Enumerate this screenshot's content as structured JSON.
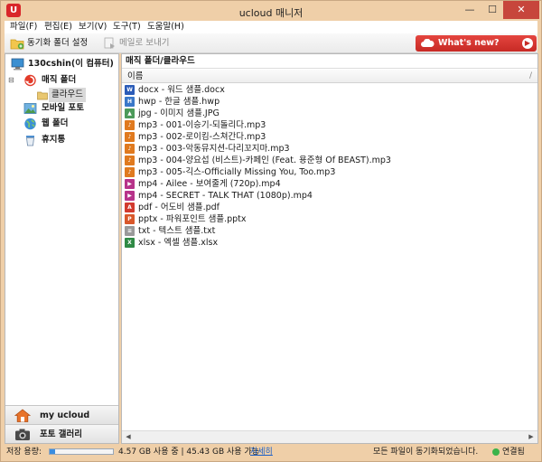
{
  "window": {
    "title": "ucloud 매니저",
    "logo": "U",
    "controls": {
      "minimize": "—",
      "maximize": "☐",
      "close": "✕"
    }
  },
  "menu": [
    "파일(F)",
    "편집(E)",
    "보기(V)",
    "도구(T)",
    "도움말(H)"
  ],
  "toolbar": {
    "sync_folder_label": "동기화 폴더 설정",
    "send_mail_label": "메일로 보내기",
    "whats_new_label": "What's new?",
    "whats_new_arrow": "▶"
  },
  "sidebar": {
    "root": {
      "label": "130cshin(이 컴퓨터)",
      "icon": "computer-icon"
    },
    "items": [
      {
        "label": "매직 폴더",
        "icon": "magic-folder-icon",
        "expander": "⊟"
      },
      {
        "label": "클라우드",
        "icon": "folder-icon"
      },
      {
        "label": "모바일 포토",
        "icon": "mobile-photo-icon"
      },
      {
        "label": "웹 폴더",
        "icon": "globe-icon"
      },
      {
        "label": "휴지통",
        "icon": "trash-icon"
      }
    ],
    "bottom_nav": [
      {
        "label": "my ucloud",
        "icon": "home-icon"
      },
      {
        "label": "포토 갤러리",
        "icon": "camera-icon"
      }
    ]
  },
  "main": {
    "path": "매직 폴더/클라우드",
    "column_header": "이름",
    "column_sep": "/",
    "files": [
      {
        "name": "docx - 워드 샘플.docx",
        "icon": "word-icon",
        "color": "#2b5cb8",
        "glyph": "W"
      },
      {
        "name": "hwp - 한글 샘플.hwp",
        "icon": "hwp-icon",
        "color": "#3a78c9",
        "glyph": "H"
      },
      {
        "name": "jpg - 이미지 샘플.JPG",
        "icon": "image-icon",
        "color": "#4c9a5a",
        "glyph": "▲"
      },
      {
        "name": "mp3 - 001-이승기-되돌리다.mp3",
        "icon": "audio-icon",
        "color": "#e07a1f",
        "glyph": "♪"
      },
      {
        "name": "mp3 - 002-로이킴-스쳐간다.mp3",
        "icon": "audio-icon",
        "color": "#e07a1f",
        "glyph": "♪"
      },
      {
        "name": "mp3 - 003-악동뮤지션-다리꼬지마.mp3",
        "icon": "audio-icon",
        "color": "#e07a1f",
        "glyph": "♪"
      },
      {
        "name": "mp3 - 004-양요섭 (비스트)-카페인 (Feat. 용준형 Of BEAST).mp3",
        "icon": "audio-icon",
        "color": "#e07a1f",
        "glyph": "♪"
      },
      {
        "name": "mp3 - 005-긱스-Officially Missing You, Too.mp3",
        "icon": "audio-icon",
        "color": "#e07a1f",
        "glyph": "♪"
      },
      {
        "name": "mp4 - Ailee - 보여줄게 (720p).mp4",
        "icon": "video-icon",
        "color": "#b7338a",
        "glyph": "▶"
      },
      {
        "name": "mp4 - SECRET - TALK THAT (1080p).mp4",
        "icon": "video-icon",
        "color": "#b7338a",
        "glyph": "▶"
      },
      {
        "name": "pdf - 어도비 샘플.pdf",
        "icon": "pdf-icon",
        "color": "#d23a2e",
        "glyph": "A"
      },
      {
        "name": "pptx - 파워포인트 샘플.pptx",
        "icon": "powerpoint-icon",
        "color": "#d9582b",
        "glyph": "P"
      },
      {
        "name": "txt - 텍스트 샘플.txt",
        "icon": "text-file-icon",
        "color": "#9a9a9a",
        "glyph": "≡"
      },
      {
        "name": "xlsx - 엑셀 샘플.xlsx",
        "icon": "excel-icon",
        "color": "#2f8a45",
        "glyph": "X"
      }
    ],
    "scroll": {
      "left": "◀",
      "right": "▶"
    }
  },
  "status": {
    "storage_label": "저장 용량:",
    "storage_used_fraction": 0.09,
    "usage_text": "4.57 GB 사용 중 | 45.43 GB 사용 가능",
    "detail_link": "자세히",
    "sync_status": "모든 파일이 동기화되었습니다.",
    "connection": "연결됨",
    "connection_color": "#3bb34a"
  },
  "colors": {
    "accent": "#d9262a",
    "frame": "#efcfa8",
    "whats_new": "#d3332d"
  }
}
